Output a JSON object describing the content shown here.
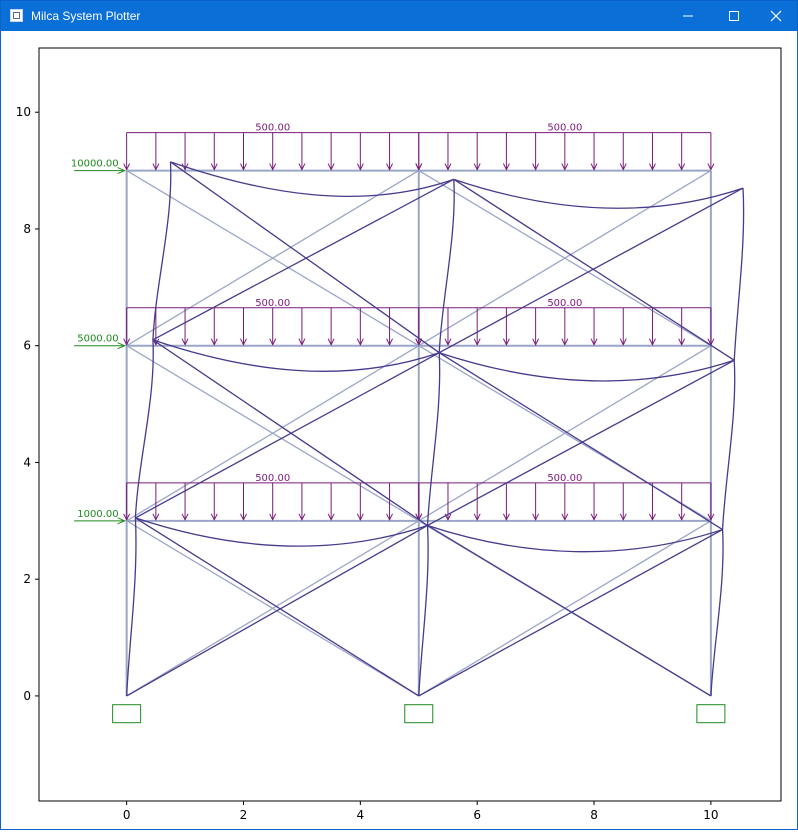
{
  "window": {
    "title": "Milca System Plotter",
    "icons": {
      "app": "plotter-app-icon",
      "minimize": "minimize-icon",
      "maximize": "maximize-icon",
      "close": "close-icon"
    }
  },
  "colors": {
    "titlebar": "#0a6fd6",
    "frame": "#9aa6c8",
    "deformed": "#463a8c",
    "load": "#7a1a7a",
    "point_load": "#1e8a1e",
    "support": "#1e8a1e"
  },
  "axes": {
    "xlim": [
      -1.5,
      11.2
    ],
    "ylim": [
      -1.8,
      11.1
    ],
    "x_ticks": [
      0,
      2,
      4,
      6,
      8,
      10
    ],
    "y_ticks": [
      0,
      2,
      4,
      6,
      8,
      10
    ]
  },
  "structure": {
    "columns_x": [
      0,
      5,
      10
    ],
    "floors_y": [
      3,
      6,
      9
    ],
    "supports_x": [
      0,
      5,
      10
    ]
  },
  "loads": {
    "distributed": [
      {
        "label": "500.00",
        "x1": 0,
        "x2": 5,
        "y": 3
      },
      {
        "label": "500.00",
        "x1": 5,
        "x2": 10,
        "y": 3
      },
      {
        "label": "500.00",
        "x1": 0,
        "x2": 5,
        "y": 6
      },
      {
        "label": "500.00",
        "x1": 5,
        "x2": 10,
        "y": 6
      },
      {
        "label": "500.00",
        "x1": 0,
        "x2": 5,
        "y": 9
      },
      {
        "label": "500.00",
        "x1": 5,
        "x2": 10,
        "y": 9
      }
    ],
    "point": [
      {
        "label": "1000.00",
        "y": 3
      },
      {
        "label": "5000.00",
        "y": 6
      },
      {
        "label": "10000.00",
        "y": 9
      }
    ]
  },
  "deformation": {
    "floors": [
      {
        "y": 3,
        "nodes": [
          [
            0.15,
            3.05
          ],
          [
            5.15,
            2.92
          ],
          [
            10.2,
            2.85
          ]
        ]
      },
      {
        "y": 6,
        "nodes": [
          [
            0.45,
            6.1
          ],
          [
            5.35,
            5.88
          ],
          [
            10.4,
            5.75
          ]
        ]
      },
      {
        "y": 9,
        "nodes": [
          [
            0.75,
            9.15
          ],
          [
            5.6,
            8.85
          ],
          [
            10.55,
            8.7
          ]
        ]
      }
    ]
  }
}
